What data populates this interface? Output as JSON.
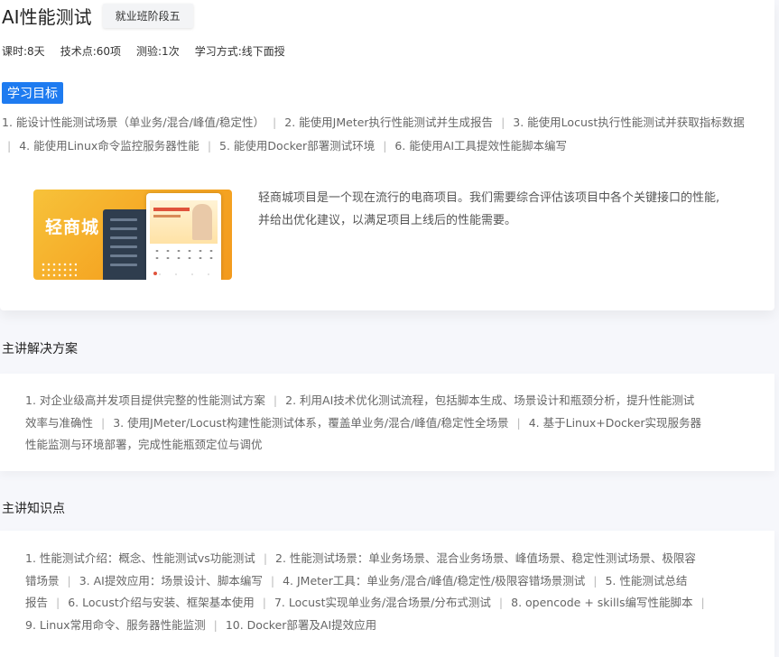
{
  "course": {
    "title": "AI性能测试",
    "stage_tag": "就业班阶段五",
    "meta": {
      "hours": "课时:8天",
      "tech_points": "技术点:60项",
      "quizzes": "测验:1次",
      "mode": "学习方式:线下面授"
    }
  },
  "goals": {
    "badge": "学习目标",
    "items": [
      "1. 能设计性能测试场景（单业务/混合/峰值/稳定性）",
      "2. 能使用JMeter执行性能测试并生成报告",
      "3. 能使用Locust执行性能测试并获取指标数据",
      "4. 能使用Linux命令监控服务器性能",
      "5. 能使用Docker部署测试环境",
      "6. 能使用AI工具提效性能脚本编写"
    ],
    "separator": "|"
  },
  "project": {
    "banner_logo_text": "轻商城",
    "desc_line1": "轻商城项目是一个现在流行的电商项目。我们需要综合评估该项目中各个关键接口的性能,",
    "desc_line2": "并给出优化建议，以满足项目上线后的性能需要。"
  },
  "solutions": {
    "heading": "主讲解决方案",
    "items": [
      "1. 对企业级高并发项目提供完整的性能测试方案",
      "2. 利用AI技术优化测试流程，包括脚本生成、场景设计和瓶颈分析，提升性能测试效率与准确性",
      "3. 使用JMeter/Locust构建性能测试体系，覆盖单业务/混合/峰值/稳定性全场景",
      "4. 基于Linux+Docker实现服务器性能监测与环境部署，完成性能瓶颈定位与调优"
    ],
    "lines": [
      [
        "1. 对企业级高并发项目提供完整的性能测试方案",
        "2. 利用AI技术优化测试流程，包括脚本生成、场景设计和瓶颈分析，提升性能测试"
      ],
      [
        "效率与准确性",
        "3. 使用JMeter/Locust构建性能测试体系，覆盖单业务/混合/峰值/稳定性全场景",
        "4. 基于Linux+Docker实现服务器"
      ],
      [
        "性能监测与环境部署，完成性能瓶颈定位与调优"
      ]
    ]
  },
  "knowledge": {
    "heading": "主讲知识点",
    "lines": [
      [
        "1. 性能测试介绍：概念、性能测试vs功能测试",
        "2. 性能测试场景：单业务场景、混合业务场景、峰值场景、稳定性测试场景、极限容"
      ],
      [
        "错场景",
        "3. AI提效应用：场景设计、脚本编写",
        "4. JMeter工具：单业务/混合/峰值/稳定性/极限容错场景测试",
        "5. 性能测试总结"
      ],
      [
        "报告",
        "6. Locust介绍与安装、框架基本使用",
        "7. Locust实现单业务/混合场景/分布式测试",
        "8. opencode + skills编写性能脚本",
        ""
      ],
      [
        "9. Linux常用命令、服务器性能监测",
        "10. Docker部署及AI提效应用"
      ]
    ]
  },
  "colors": {
    "accent_blue": "#1e7bf0",
    "banner_orange": "#f5a623",
    "text_gray": "#666666"
  }
}
